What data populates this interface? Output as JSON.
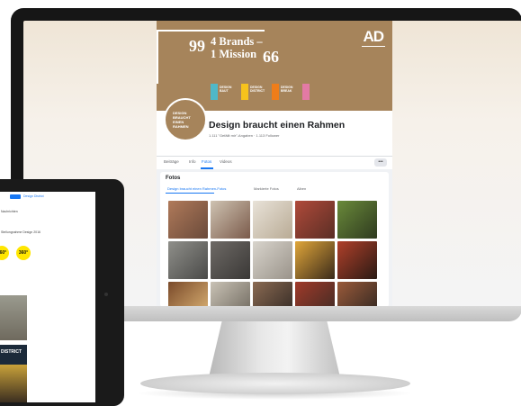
{
  "cover": {
    "quote_open": "99",
    "quote_close": "66",
    "tagline_line1": "4 Brands –",
    "tagline_line2": "1 Mission",
    "logo": "AD",
    "brands": [
      {
        "label": "DESIGN\nBAUT",
        "color": "#4fb8c8"
      },
      {
        "label": "DESIGN\nDISTRICT",
        "color": "#f6c21c"
      },
      {
        "label": "DESIGN\nBREAK",
        "color": "#ef7d1a"
      },
      {
        "label": "",
        "color": "#e37aa4"
      }
    ]
  },
  "profile": {
    "avatar_text": "DESIGN BRAUCHT EINEN RAHMEN",
    "name": "Design braucht einen Rahmen",
    "stats": "1.111 \"Gefällt mir\"-Angaben · 1.113 Follower"
  },
  "tabs": {
    "items": [
      "Beiträge",
      "Info",
      "Fotos",
      "Videos"
    ],
    "active": "Fotos",
    "more": "•••"
  },
  "photos": {
    "title": "Fotos",
    "subtabs": [
      "Design braucht einen Rahmen-Fotos",
      "Markierte Fotos",
      "Alben"
    ],
    "thumbs": [
      {
        "color_a": "#b07a5a",
        "color_b": "#6a4a3a"
      },
      {
        "color_a": "#cfc3b2",
        "color_b": "#7a5a4a"
      },
      {
        "color_a": "#e8e2d8",
        "color_b": "#b9ab95"
      },
      {
        "color_a": "#b04a3a",
        "color_b": "#5a2e25"
      },
      {
        "color_a": "#6a8a3a",
        "color_b": "#2e3a1f"
      },
      {
        "color_a": "#8f8f8a",
        "color_b": "#4a4a48"
      },
      {
        "color_a": "#6e6a66",
        "color_b": "#3a3836"
      },
      {
        "color_a": "#d8d4cc",
        "color_b": "#9a938a"
      },
      {
        "color_a": "#e0a63a",
        "color_b": "#3a2a1a"
      },
      {
        "color_a": "#b0402a",
        "color_b": "#2a1a14"
      },
      {
        "color_a": "#7a4a2a",
        "color_b": "#e0b878"
      },
      {
        "color_a": "#c9c2b5",
        "color_b": "#6a645a"
      },
      {
        "color_a": "#8a6a52",
        "color_b": "#2e2622"
      },
      {
        "color_a": "#a03a2a",
        "color_b": "#3a2a24"
      },
      {
        "color_a": "#9a5a3a",
        "color_b": "#2a2420"
      }
    ]
  },
  "tablet": {
    "button": "",
    "link": "Design District",
    "line1": "Nachrichten",
    "line2": "Stellungnahme Design 2016",
    "dot1": "360°",
    "dot2": "360°",
    "banner": "DISTRICT"
  },
  "colors": {
    "cover_brown": "#a6845b",
    "facebook_blue": "#1877f2",
    "dark_frame": "#161616"
  }
}
